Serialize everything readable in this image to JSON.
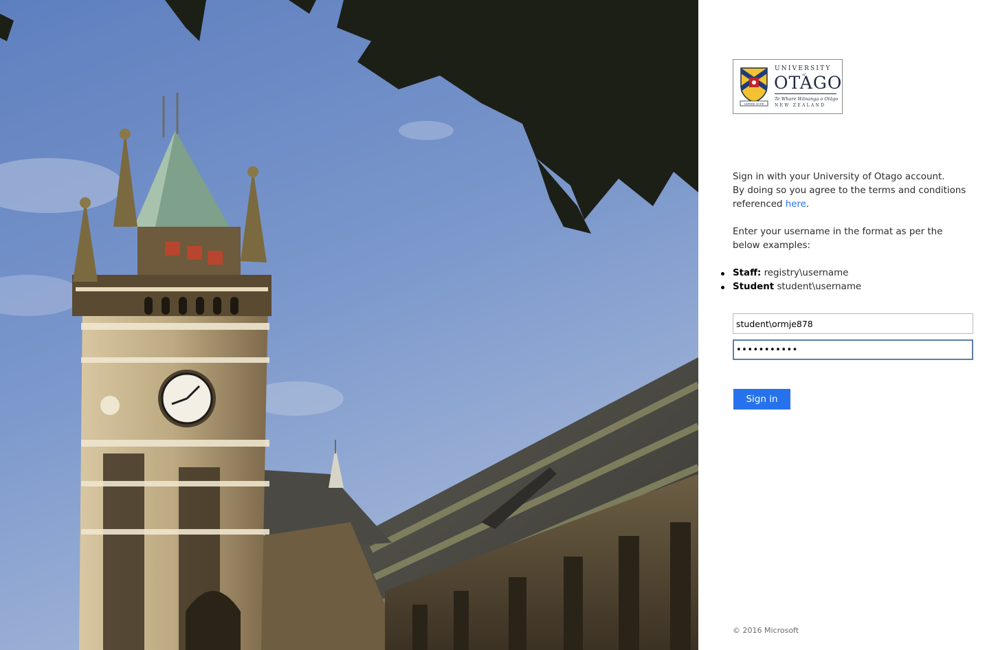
{
  "logo": {
    "university": "UNIVERSITY",
    "of": "of",
    "name": "OTAGO",
    "maori": "Te Whare Wānanga o Otāgo",
    "country": "NEW ZEALAND",
    "motto": "SAPERE AUDE"
  },
  "intro": {
    "line1": "Sign in with your University of Otago account.",
    "line2": "By doing so you agree to the terms and conditions referenced ",
    "link": "here",
    "line2_end": ".",
    "line3": "Enter your username in the format as per the below examples:"
  },
  "examples": [
    {
      "label": "Staff:",
      "value": "registry\\username"
    },
    {
      "label": "Student",
      "value": "student\\username"
    }
  ],
  "username": {
    "value": "student\\ormje878"
  },
  "password": {
    "value": "•••••••••••"
  },
  "signin_label": "Sign in",
  "footer": "© 2016 Microsoft"
}
